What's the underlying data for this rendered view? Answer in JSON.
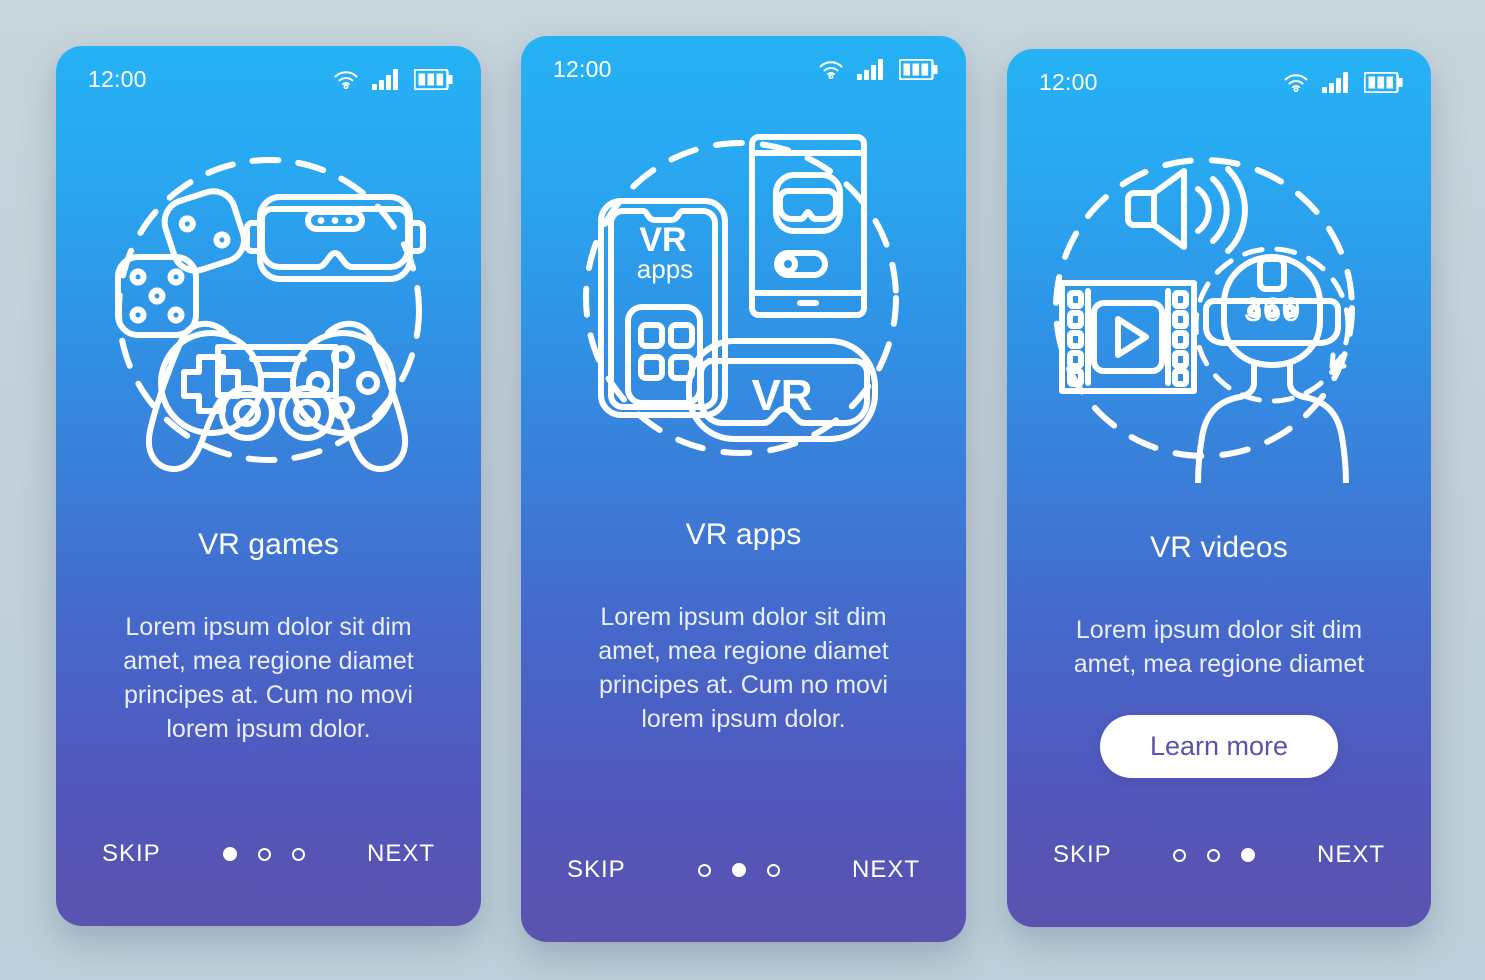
{
  "background": {
    "color": "#c3d2db"
  },
  "theme": {
    "gradient_top": "#26b2f5",
    "gradient_bottom": "#5a53b0",
    "accent_purple": "#5a53ab",
    "text_white": "#ffffff"
  },
  "screens": [
    {
      "id": "vr-games",
      "status_bar": {
        "time": "12:00",
        "icons": [
          "wifi-icon",
          "cellular-signal-icon",
          "battery-icon"
        ]
      },
      "illustration": {
        "name": "vr-games-illustration",
        "elements": [
          "dice-icon",
          "dice-icon",
          "vr-headset-icon",
          "gamepad-icon",
          "dashed-circle"
        ]
      },
      "title": "VR games",
      "body": "Lorem ipsum dolor sit dim amet, mea regione diamet principes at. Cum no movi lorem ipsum dolor.",
      "cta": null,
      "nav": {
        "skip_label": "SKIP",
        "next_label": "NEXT",
        "dots_total": 3,
        "dot_active_index": 0
      }
    },
    {
      "id": "vr-apps",
      "status_bar": {
        "time": "12:00",
        "icons": [
          "wifi-icon",
          "cellular-signal-icon",
          "battery-icon"
        ]
      },
      "illustration": {
        "name": "vr-apps-illustration",
        "phone_label_line1": "VR",
        "phone_label_line2": "apps",
        "goggles_label": "VR",
        "elements": [
          "smartphone-icon",
          "tablet-icon",
          "vr-goggles-icon",
          "toggle-switch-icon",
          "app-grid-icon",
          "dashed-circle"
        ]
      },
      "title": "VR apps",
      "body": "Lorem ipsum dolor sit dim amet, mea regione diamet principes at. Cum no movi lorem ipsum dolor.",
      "cta": null,
      "nav": {
        "skip_label": "SKIP",
        "next_label": "NEXT",
        "dots_total": 3,
        "dot_active_index": 1
      }
    },
    {
      "id": "vr-videos",
      "status_bar": {
        "time": "12:00",
        "icons": [
          "wifi-icon",
          "cellular-signal-icon",
          "battery-icon"
        ]
      },
      "illustration": {
        "name": "vr-videos-illustration",
        "headset_label": "360",
        "elements": [
          "speaker-icon",
          "film-strip-play-icon",
          "person-vr-headset-icon",
          "dashed-circle",
          "rotate-arrow-icon"
        ]
      },
      "title": "VR videos",
      "body": "Lorem ipsum dolor sit dim amet, mea regione diamet",
      "cta": {
        "label": "Learn more"
      },
      "nav": {
        "skip_label": "SKIP",
        "next_label": "NEXT",
        "dots_total": 3,
        "dot_active_index": 2
      }
    }
  ]
}
